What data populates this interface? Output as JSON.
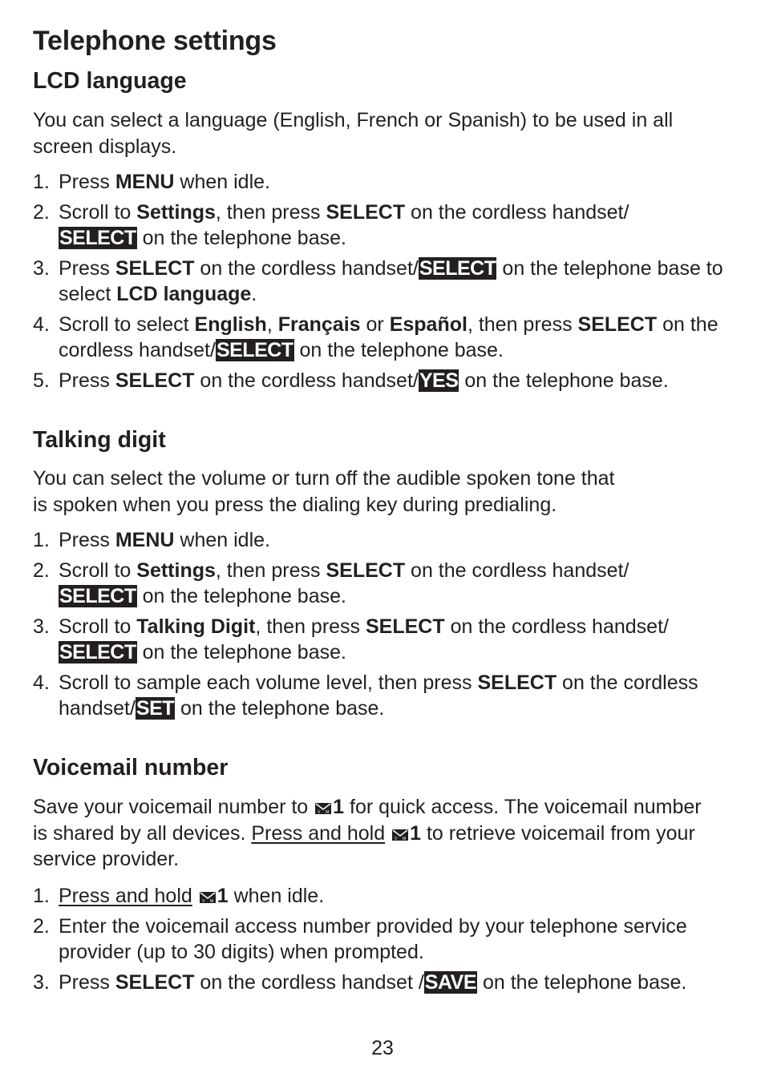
{
  "page_title": "Telephone settings",
  "page_number": "23",
  "sections": {
    "lcd": {
      "title": "LCD language",
      "intro": "You can select a language (English, French or Spanish) to be used in all screen displays.",
      "steps": [
        {
          "num": "1.",
          "t1": "Press ",
          "b1": "MENU",
          "t2": " when idle."
        },
        {
          "num": "2.",
          "t1": "Scroll to ",
          "b1": "Settings",
          "t2": ", then press ",
          "b2": "SELECT",
          "t3": " on the cordless handset/",
          "k1": "SELECT",
          "t4": " on the telephone base."
        },
        {
          "num": "3.",
          "t1": "Press ",
          "b1": "SELECT",
          "t2": " on the cordless handset/",
          "k1": "SELECT",
          "t3": " on the telephone base to select ",
          "b2": "LCD language",
          "t4": "."
        },
        {
          "num": "4.",
          "t1": "Scroll to select ",
          "b1": "English",
          "t2": ", ",
          "b2": "Français",
          "t3": " or ",
          "b3": "Español",
          "t4": ", then press ",
          "b4": "SELECT",
          "t5": " on the cordless handset/",
          "k1": "SELECT",
          "t6": " on the telephone base."
        },
        {
          "num": "5.",
          "t1": "Press ",
          "b1": "SELECT",
          "t2": " on the cordless handset/",
          "k1": "YES",
          "t3": " on the telephone base."
        }
      ]
    },
    "talking": {
      "title": "Talking digit",
      "intro_line1": "You can select the volume or turn off the audible spoken tone that",
      "intro_line2": "is spoken when you press the dialing key during predialing.",
      "steps": [
        {
          "num": "1.",
          "t1": "Press ",
          "b1": "MENU",
          "t2": " when idle."
        },
        {
          "num": "2.",
          "t1": "Scroll to ",
          "b1": "Settings",
          "t2": ", then press ",
          "b2": "SELECT",
          "t3": " on the cordless handset/",
          "k1": "SELECT",
          "t4": " on the telephone base."
        },
        {
          "num": "3.",
          "t1": "Scroll to ",
          "b1": "Talking Digit",
          "t2": ", then press ",
          "b2": "SELECT",
          "t3": " on the cordless handset/",
          "k1": "SELECT",
          "t4": " on the telephone base."
        },
        {
          "num": "4.",
          "t1": "Scroll to sample each volume level, then press ",
          "b1": "SELECT",
          "t2": " on the cordless handset/",
          "k1": "SET",
          "t3": " on the telephone base."
        }
      ]
    },
    "voicemail": {
      "title": "Voicemail number",
      "intro": {
        "t1": "Save your voicemail number to ",
        "key1": "1",
        "t2": " for quick access. The voicemail number is shared by all devices. ",
        "u1": "Press and hold",
        "key2": "1",
        "t3": " to retrieve voicemail from your service provider."
      },
      "icon": "voicemail-envelope-icon",
      "steps": [
        {
          "num": "1.",
          "u1": "Press and hold",
          "b1": "1",
          "t1": " when idle."
        },
        {
          "num": "2.",
          "t1": "Enter the voicemail access number provided by your telephone service provider (up to 30 digits) when prompted."
        },
        {
          "num": "3.",
          "t1": "Press ",
          "b1": "SELECT",
          "t2": " on the cordless handset /",
          "k1": "SAVE",
          "t3": " on the telephone base."
        }
      ]
    }
  }
}
